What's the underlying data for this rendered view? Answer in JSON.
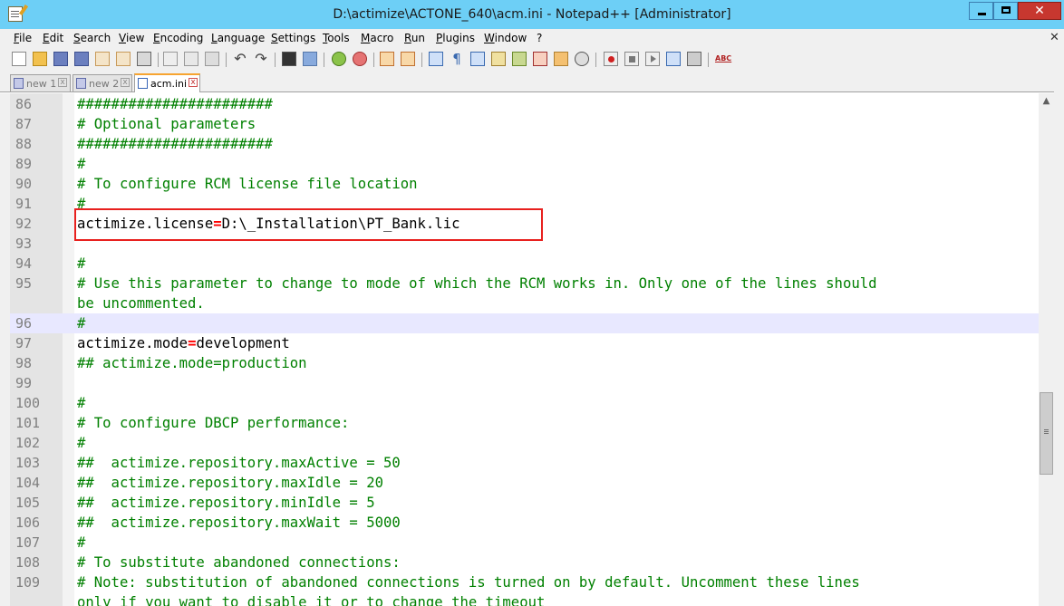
{
  "window": {
    "title": "D:\\actimize\\ACTONE_640\\acm.ini - Notepad++ [Administrator]",
    "min_label": "",
    "max_label": "",
    "close_label": "✕"
  },
  "menu": [
    {
      "label": "File"
    },
    {
      "label": "Edit"
    },
    {
      "label": "Search"
    },
    {
      "label": "View"
    },
    {
      "label": "Encoding"
    },
    {
      "label": "Language"
    },
    {
      "label": "Settings"
    },
    {
      "label": "Tools"
    },
    {
      "label": "Macro"
    },
    {
      "label": "Run"
    },
    {
      "label": "Plugins"
    },
    {
      "label": "Window"
    },
    {
      "label": "?"
    }
  ],
  "menu_close": "✕",
  "toolbar": {
    "icons": [
      "new-file-icon",
      "open-file-icon",
      "save-icon",
      "save-all-icon",
      "close-icon",
      "close-all-icon",
      "print-icon",
      "cut-icon",
      "copy-icon",
      "paste-icon",
      "undo-icon",
      "redo-icon",
      "find-icon",
      "replace-icon",
      "zoom-in-icon",
      "zoom-out-icon",
      "sync-vertical-icon",
      "sync-horizontal-icon",
      "word-wrap-icon",
      "show-all-chars-icon",
      "indent-guide-icon",
      "user-language-icon",
      "document-map-icon",
      "function-list-icon",
      "folder-workspace-icon",
      "monitor-icon",
      "record-macro-icon",
      "stop-macro-icon",
      "play-macro-icon",
      "run-macro-multiple-icon",
      "save-macro-icon",
      "spell-check-icon"
    ],
    "spell_label": "ABC"
  },
  "tabs": [
    {
      "label": "new 1",
      "active": false
    },
    {
      "label": "new 2",
      "active": false
    },
    {
      "label": "acm.ini",
      "active": true
    }
  ],
  "tab_close": "x",
  "editor": {
    "lines": [
      {
        "n": "86",
        "parts": [
          {
            "t": "#######################",
            "c": "cmt"
          }
        ]
      },
      {
        "n": "87",
        "parts": [
          {
            "t": "# Optional parameters",
            "c": "cmt"
          }
        ]
      },
      {
        "n": "88",
        "parts": [
          {
            "t": "#######################",
            "c": "cmt"
          }
        ]
      },
      {
        "n": "89",
        "parts": [
          {
            "t": "#",
            "c": "cmt"
          }
        ]
      },
      {
        "n": "90",
        "parts": [
          {
            "t": "# To configure RCM license file location",
            "c": "cmt"
          }
        ]
      },
      {
        "n": "91",
        "parts": [
          {
            "t": "#",
            "c": "cmt"
          }
        ]
      },
      {
        "n": "92",
        "parts": [
          {
            "t": "actimize.license",
            "c": ""
          },
          {
            "t": "=",
            "c": "eq"
          },
          {
            "t": "D:\\_Installation\\PT_Bank.lic",
            "c": ""
          }
        ]
      },
      {
        "n": "93",
        "parts": []
      },
      {
        "n": "94",
        "parts": [
          {
            "t": "#",
            "c": "cmt"
          }
        ]
      },
      {
        "n": "95",
        "parts": [
          {
            "t": "# Use this parameter to change to mode of which the RCM works in. Only one of the lines should",
            "c": "cmt"
          }
        ]
      },
      {
        "n": "",
        "parts": [
          {
            "t": "be uncommented.",
            "c": "cmt"
          }
        ]
      },
      {
        "n": "96",
        "parts": [
          {
            "t": "#",
            "c": "cmt"
          }
        ],
        "current": true
      },
      {
        "n": "97",
        "parts": [
          {
            "t": "actimize.mode",
            "c": ""
          },
          {
            "t": "=",
            "c": "eq"
          },
          {
            "t": "development",
            "c": ""
          }
        ]
      },
      {
        "n": "98",
        "parts": [
          {
            "t": "## actimize.mode=production",
            "c": "cmt"
          }
        ]
      },
      {
        "n": "99",
        "parts": []
      },
      {
        "n": "100",
        "parts": [
          {
            "t": "#",
            "c": "cmt"
          }
        ]
      },
      {
        "n": "101",
        "parts": [
          {
            "t": "# To configure DBCP performance:",
            "c": "cmt"
          }
        ]
      },
      {
        "n": "102",
        "parts": [
          {
            "t": "#",
            "c": "cmt"
          }
        ]
      },
      {
        "n": "103",
        "parts": [
          {
            "t": "##  actimize.repository.maxActive = 50",
            "c": "cmt"
          }
        ]
      },
      {
        "n": "104",
        "parts": [
          {
            "t": "##  actimize.repository.maxIdle = 20",
            "c": "cmt"
          }
        ]
      },
      {
        "n": "105",
        "parts": [
          {
            "t": "##  actimize.repository.minIdle = 5",
            "c": "cmt"
          }
        ]
      },
      {
        "n": "106",
        "parts": [
          {
            "t": "##  actimize.repository.maxWait = 5000",
            "c": "cmt"
          }
        ]
      },
      {
        "n": "107",
        "parts": [
          {
            "t": "#",
            "c": "cmt"
          }
        ]
      },
      {
        "n": "108",
        "parts": [
          {
            "t": "# To substitute abandoned connections:",
            "c": "cmt"
          }
        ]
      },
      {
        "n": "109",
        "parts": [
          {
            "t": "# Note: substitution of abandoned connections is turned on by default. Uncomment these lines",
            "c": "cmt"
          }
        ]
      },
      {
        "n": "",
        "parts": [
          {
            "t": "only if you want to disable it or to change the timeout",
            "c": "cmt"
          }
        ]
      }
    ]
  },
  "scrollbar": {
    "up": "▲"
  },
  "colors": {
    "titlebar": "#6dcff6",
    "comment": "#008000",
    "operator": "#ff0000",
    "highlight_box": "#e8201e",
    "current_line": "#e8e8ff"
  }
}
